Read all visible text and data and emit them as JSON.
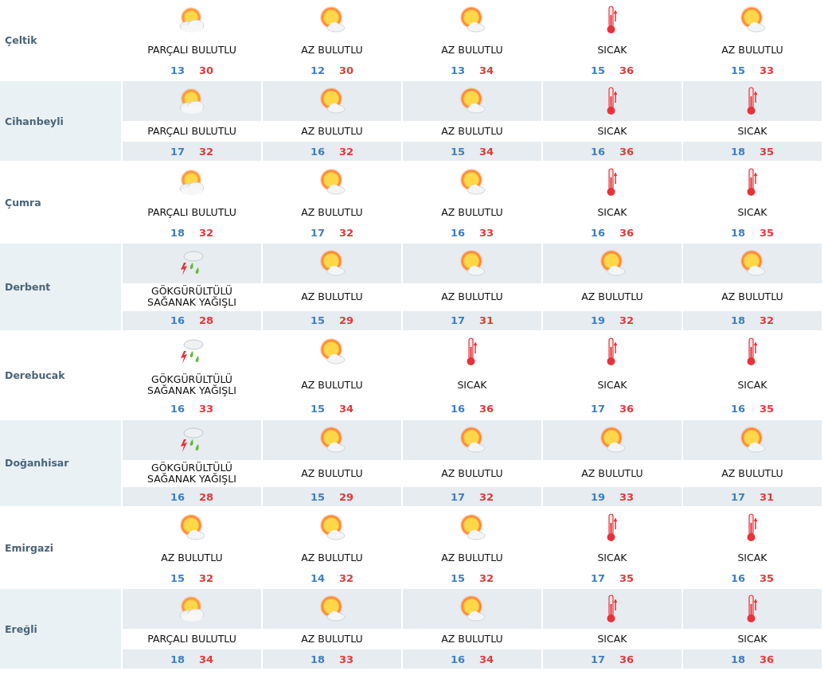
{
  "rows": [
    {
      "city": "Çeltik",
      "days": [
        {
          "kind": "partly",
          "condition": "PARÇALI BULUTLU",
          "low": "13",
          "high": "30"
        },
        {
          "kind": "few",
          "condition": "AZ BULUTLU",
          "low": "12",
          "high": "30"
        },
        {
          "kind": "few",
          "condition": "AZ BULUTLU",
          "low": "13",
          "high": "34"
        },
        {
          "kind": "hot",
          "condition": "SICAK",
          "low": "15",
          "high": "36"
        },
        {
          "kind": "few",
          "condition": "AZ BULUTLU",
          "low": "15",
          "high": "33"
        }
      ]
    },
    {
      "city": "Cihanbeyli",
      "days": [
        {
          "kind": "partly",
          "condition": "PARÇALI BULUTLU",
          "low": "17",
          "high": "32"
        },
        {
          "kind": "few",
          "condition": "AZ BULUTLU",
          "low": "16",
          "high": "32"
        },
        {
          "kind": "few",
          "condition": "AZ BULUTLU",
          "low": "15",
          "high": "34"
        },
        {
          "kind": "hot",
          "condition": "SICAK",
          "low": "16",
          "high": "36"
        },
        {
          "kind": "hot",
          "condition": "SICAK",
          "low": "18",
          "high": "35"
        }
      ]
    },
    {
      "city": "Çumra",
      "days": [
        {
          "kind": "partly",
          "condition": "PARÇALI BULUTLU",
          "low": "18",
          "high": "32"
        },
        {
          "kind": "few",
          "condition": "AZ BULUTLU",
          "low": "17",
          "high": "32"
        },
        {
          "kind": "few",
          "condition": "AZ BULUTLU",
          "low": "16",
          "high": "33"
        },
        {
          "kind": "hot",
          "condition": "SICAK",
          "low": "16",
          "high": "36"
        },
        {
          "kind": "hot",
          "condition": "SICAK",
          "low": "18",
          "high": "35"
        }
      ]
    },
    {
      "city": "Derbent",
      "days": [
        {
          "kind": "storm",
          "condition": "GÖKGÜRÜLTÜLÜ SAĞANAK YAĞIŞLI",
          "low": "16",
          "high": "28"
        },
        {
          "kind": "few",
          "condition": "AZ BULUTLU",
          "low": "15",
          "high": "29"
        },
        {
          "kind": "few",
          "condition": "AZ BULUTLU",
          "low": "17",
          "high": "31"
        },
        {
          "kind": "few",
          "condition": "AZ BULUTLU",
          "low": "19",
          "high": "32"
        },
        {
          "kind": "few",
          "condition": "AZ BULUTLU",
          "low": "18",
          "high": "32"
        }
      ]
    },
    {
      "city": "Derebucak",
      "days": [
        {
          "kind": "storm",
          "condition": "GÖKGÜRÜLTÜLÜ SAĞANAK YAĞIŞLI",
          "low": "16",
          "high": "33"
        },
        {
          "kind": "few",
          "condition": "AZ BULUTLU",
          "low": "15",
          "high": "34"
        },
        {
          "kind": "hot",
          "condition": "SICAK",
          "low": "16",
          "high": "36"
        },
        {
          "kind": "hot",
          "condition": "SICAK",
          "low": "17",
          "high": "36"
        },
        {
          "kind": "hot",
          "condition": "SICAK",
          "low": "16",
          "high": "35"
        }
      ]
    },
    {
      "city": "Doğanhisar",
      "days": [
        {
          "kind": "storm",
          "condition": "GÖKGÜRÜLTÜLÜ SAĞANAK YAĞIŞLI",
          "low": "16",
          "high": "28"
        },
        {
          "kind": "few",
          "condition": "AZ BULUTLU",
          "low": "15",
          "high": "29"
        },
        {
          "kind": "few",
          "condition": "AZ BULUTLU",
          "low": "17",
          "high": "32"
        },
        {
          "kind": "few",
          "condition": "AZ BULUTLU",
          "low": "19",
          "high": "33"
        },
        {
          "kind": "few",
          "condition": "AZ BULUTLU",
          "low": "17",
          "high": "31"
        }
      ]
    },
    {
      "city": "Emirgazi",
      "days": [
        {
          "kind": "few",
          "condition": "AZ BULUTLU",
          "low": "15",
          "high": "32"
        },
        {
          "kind": "few",
          "condition": "AZ BULUTLU",
          "low": "14",
          "high": "32"
        },
        {
          "kind": "few",
          "condition": "AZ BULUTLU",
          "low": "15",
          "high": "32"
        },
        {
          "kind": "hot",
          "condition": "SICAK",
          "low": "17",
          "high": "35"
        },
        {
          "kind": "hot",
          "condition": "SICAK",
          "low": "16",
          "high": "35"
        }
      ]
    },
    {
      "city": "Ereğli",
      "days": [
        {
          "kind": "partly",
          "condition": "PARÇALI BULUTLU",
          "low": "18",
          "high": "34"
        },
        {
          "kind": "few",
          "condition": "AZ BULUTLU",
          "low": "18",
          "high": "33"
        },
        {
          "kind": "few",
          "condition": "AZ BULUTLU",
          "low": "16",
          "high": "34"
        },
        {
          "kind": "hot",
          "condition": "SICAK",
          "low": "17",
          "high": "36"
        },
        {
          "kind": "hot",
          "condition": "SICAK",
          "low": "18",
          "high": "36"
        }
      ]
    }
  ]
}
